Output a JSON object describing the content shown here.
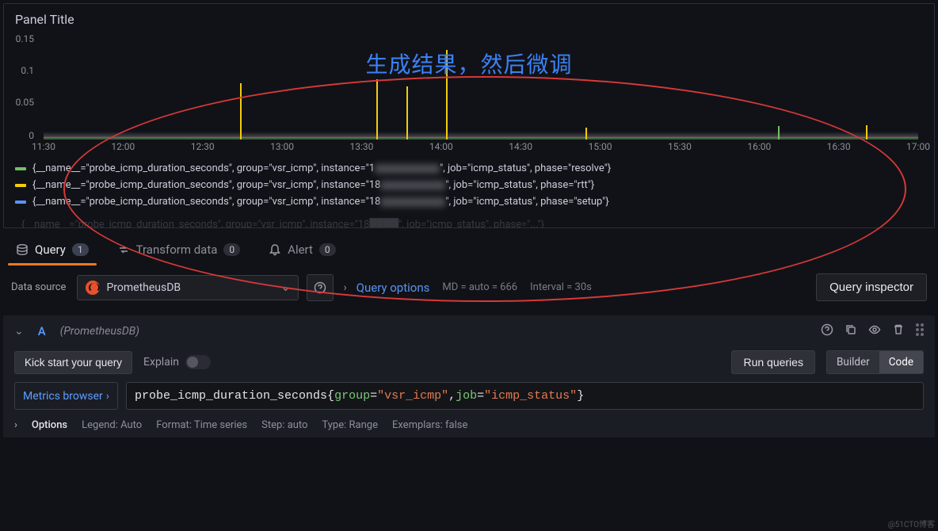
{
  "panel": {
    "title": "Panel Title"
  },
  "annotation": {
    "text": "生成结果，然后微调"
  },
  "chart_data": {
    "type": "line",
    "title": "Panel Title",
    "xlabel": "",
    "ylabel": "",
    "y_ticks": [
      "0",
      "0.05",
      "0.1",
      "0.15"
    ],
    "ylim": [
      0,
      0.15
    ],
    "x_ticks": [
      "11:30",
      "12:00",
      "12:30",
      "13:00",
      "13:30",
      "14:00",
      "14:30",
      "15:00",
      "15:30",
      "16:00",
      "16:30",
      "17:00"
    ],
    "series": [
      {
        "name": "{__name__=\"probe_icmp_duration_seconds\", group=\"vsr_icmp\", instance=\"18████\", job=\"icmp_status\", phase=\"resolve\"}",
        "color": "#73bf69"
      },
      {
        "name": "{__name__=\"probe_icmp_duration_seconds\", group=\"vsr_icmp\", instance=\"18████\", job=\"icmp_status\", phase=\"rtt\"}",
        "color": "#f2cc0c"
      },
      {
        "name": "{__name__=\"probe_icmp_duration_seconds\", group=\"vsr_icmp\", instance=\"18████\", job=\"icmp_status\", phase=\"setup\"}",
        "color": "#5794f2"
      }
    ],
    "spikes": [
      {
        "x_pct": 22.5,
        "value": 0.085,
        "color": "#f2cc0c"
      },
      {
        "x_pct": 38.0,
        "value": 0.09,
        "color": "#f2cc0c"
      },
      {
        "x_pct": 41.5,
        "value": 0.08,
        "color": "#f2cc0c"
      },
      {
        "x_pct": 46.0,
        "value": 0.135,
        "color": "#f2cc0c"
      },
      {
        "x_pct": 62.0,
        "value": 0.018,
        "color": "#f2cc0c"
      },
      {
        "x_pct": 84.0,
        "value": 0.02,
        "color": "#73bf69"
      },
      {
        "x_pct": 94.0,
        "value": 0.022,
        "color": "#f2cc0c"
      }
    ]
  },
  "legend": [
    {
      "color": "#73bf69",
      "pre": "{__name__=\"probe_icmp_duration_seconds\", group=\"vsr_icmp\", instance=\"1",
      "post": "\", job=\"icmp_status\", phase=\"resolve\"}"
    },
    {
      "color": "#f2cc0c",
      "pre": "{__name__=\"probe_icmp_duration_seconds\", group=\"vsr_icmp\", instance=\"18",
      "post": "\", job=\"icmp_status\", phase=\"rtt\"}"
    },
    {
      "color": "#5794f2",
      "pre": "{__name__=\"probe_icmp_duration_seconds\", group=\"vsr_icmp\", instance=\"18",
      "post": "\", job=\"icmp_status\", phase=\"setup\"}"
    }
  ],
  "tabs": {
    "query": {
      "label": "Query",
      "badge": "1"
    },
    "transform": {
      "label": "Transform data",
      "badge": "0"
    },
    "alert": {
      "label": "Alert",
      "badge": "0"
    }
  },
  "datasource": {
    "label": "Data source",
    "name": "PrometheusDB"
  },
  "query_options": {
    "link": "Query options",
    "md": "MD = auto = 666",
    "interval": "Interval = 30s"
  },
  "inspector": {
    "label": "Query inspector"
  },
  "query_row": {
    "letter": "A",
    "ds_hint": "(PrometheusDB)",
    "kick": "Kick start your query",
    "explain": "Explain",
    "run": "Run queries",
    "builder": "Builder",
    "code": "Code",
    "metrics_browser": "Metrics browser",
    "expr": {
      "metric": "probe_icmp_duration_seconds",
      "l1": "group",
      "v1": "\"vsr_icmp\"",
      "l2": "job",
      "v2": "\"icmp_status\""
    }
  },
  "options": {
    "title": "Options",
    "legend": "Legend: Auto",
    "format": "Format: Time series",
    "step": "Step: auto",
    "type": "Type: Range",
    "exemplars": "Exemplars: false"
  },
  "watermark": "@51CTO博客"
}
